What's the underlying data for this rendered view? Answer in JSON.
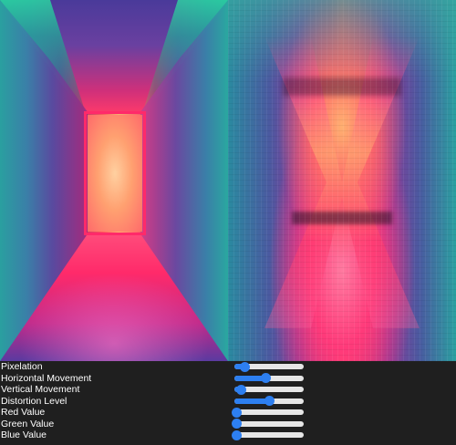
{
  "images": {
    "original_name": "neon-corridor-original",
    "processed_name": "neon-corridor-distorted"
  },
  "controls": [
    {
      "key": "pixelation",
      "label": "Pixelation",
      "value": 0.15
    },
    {
      "key": "horizontal_movement",
      "label": "Horizontal Movement",
      "value": 0.45
    },
    {
      "key": "vertical_movement",
      "label": "Vertical Movement",
      "value": 0.1
    },
    {
      "key": "distortion_level",
      "label": "Distortion Level",
      "value": 0.5
    },
    {
      "key": "red_value",
      "label": "Red Value",
      "value": 0.0
    },
    {
      "key": "green_value",
      "label": "Green Value",
      "value": 0.0
    },
    {
      "key": "blue_value",
      "label": "Blue Value",
      "value": 0.0
    }
  ],
  "colors": {
    "panel_background": "#1f1f1f",
    "label_text": "#ffffff",
    "slider_track": "#e6e6e6",
    "slider_accent": "#2d7ff0"
  }
}
